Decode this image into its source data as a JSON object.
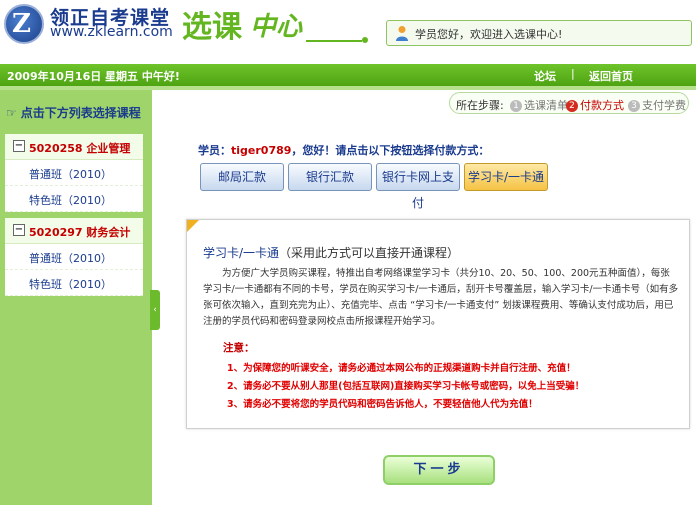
{
  "header": {
    "logo_glyph": "Z",
    "logo_text": "领正自考课堂",
    "logo_url": "www.zklearn.com",
    "title_part1": "选课",
    "title_part2": "中心",
    "welcome": "学员您好，欢迎进入选课中心!"
  },
  "nav": {
    "date": "2009年10月16日   星期五   中午好!",
    "forum": "论坛",
    "separator": "|",
    "home": "返回首页"
  },
  "sidebar": {
    "title": "点击下方列表选择课程",
    "groups": [
      {
        "code": "5020258 企业管理",
        "items": [
          "普通班（2010）",
          "特色班（2010）"
        ]
      },
      {
        "code": "5020297 财务会计",
        "items": [
          "普通班（2010）",
          "特色班（2010）"
        ]
      }
    ],
    "collapse_glyph": "‹"
  },
  "steps": {
    "label": "所在步骤:",
    "items": [
      {
        "num": "1",
        "label": "选课清单",
        "active": false
      },
      {
        "num": "2",
        "label": "付款方式",
        "active": true
      },
      {
        "num": "3",
        "label": "支付学费",
        "active": false
      }
    ]
  },
  "main": {
    "prompt_prefix": "学员：",
    "username": "tiger0789",
    "prompt_suffix": "，您好！请点击以下按钮选择付款方式：",
    "payment_buttons": [
      {
        "label": "邮局汇款",
        "selected": false
      },
      {
        "label": "银行汇款",
        "selected": false
      },
      {
        "label": "银行卡网上支付",
        "selected": false
      },
      {
        "label": "学习卡/一卡通",
        "selected": true
      }
    ],
    "card": {
      "title": "学习卡/一卡通",
      "title_note": "（采用此方式可以直接开通课程）",
      "body": "为方便广大学员购买课程，特推出自考网络课堂学习卡（共分10、20、50、100、200元五种面值），每张学习卡/一卡通都有不同的卡号，学员在购买学习卡/一卡通后，刮开卡号覆盖层，输入学习卡/一卡通卡号（如有多张可依次输入，直到充完为止）、充值完毕、点击 “学习卡/一卡通支付” 划拨课程费用、等确认支付成功后，用已注册的学员代码和密码登录网校点击所报课程开始学习。",
      "note_title": "注意：",
      "notes": [
        "1、为保障您的听课安全，请务必通过本网公布的正规渠道购卡并自行注册、充值！",
        "2、请务必不要从别人那里(包括互联网)直接购买学习卡帐号或密码，以免上当受骗！",
        "3、请务必不要将您的学员代码和密码告诉他人，不要轻信他人代为充值！"
      ]
    },
    "next_button": "下一步"
  },
  "colors": {
    "brand_green": "#63b61f",
    "bar_green": "#4ea312",
    "sidebar_green": "#9fd46a",
    "navy": "#1a3b8e",
    "alert_red": "#c40000"
  }
}
